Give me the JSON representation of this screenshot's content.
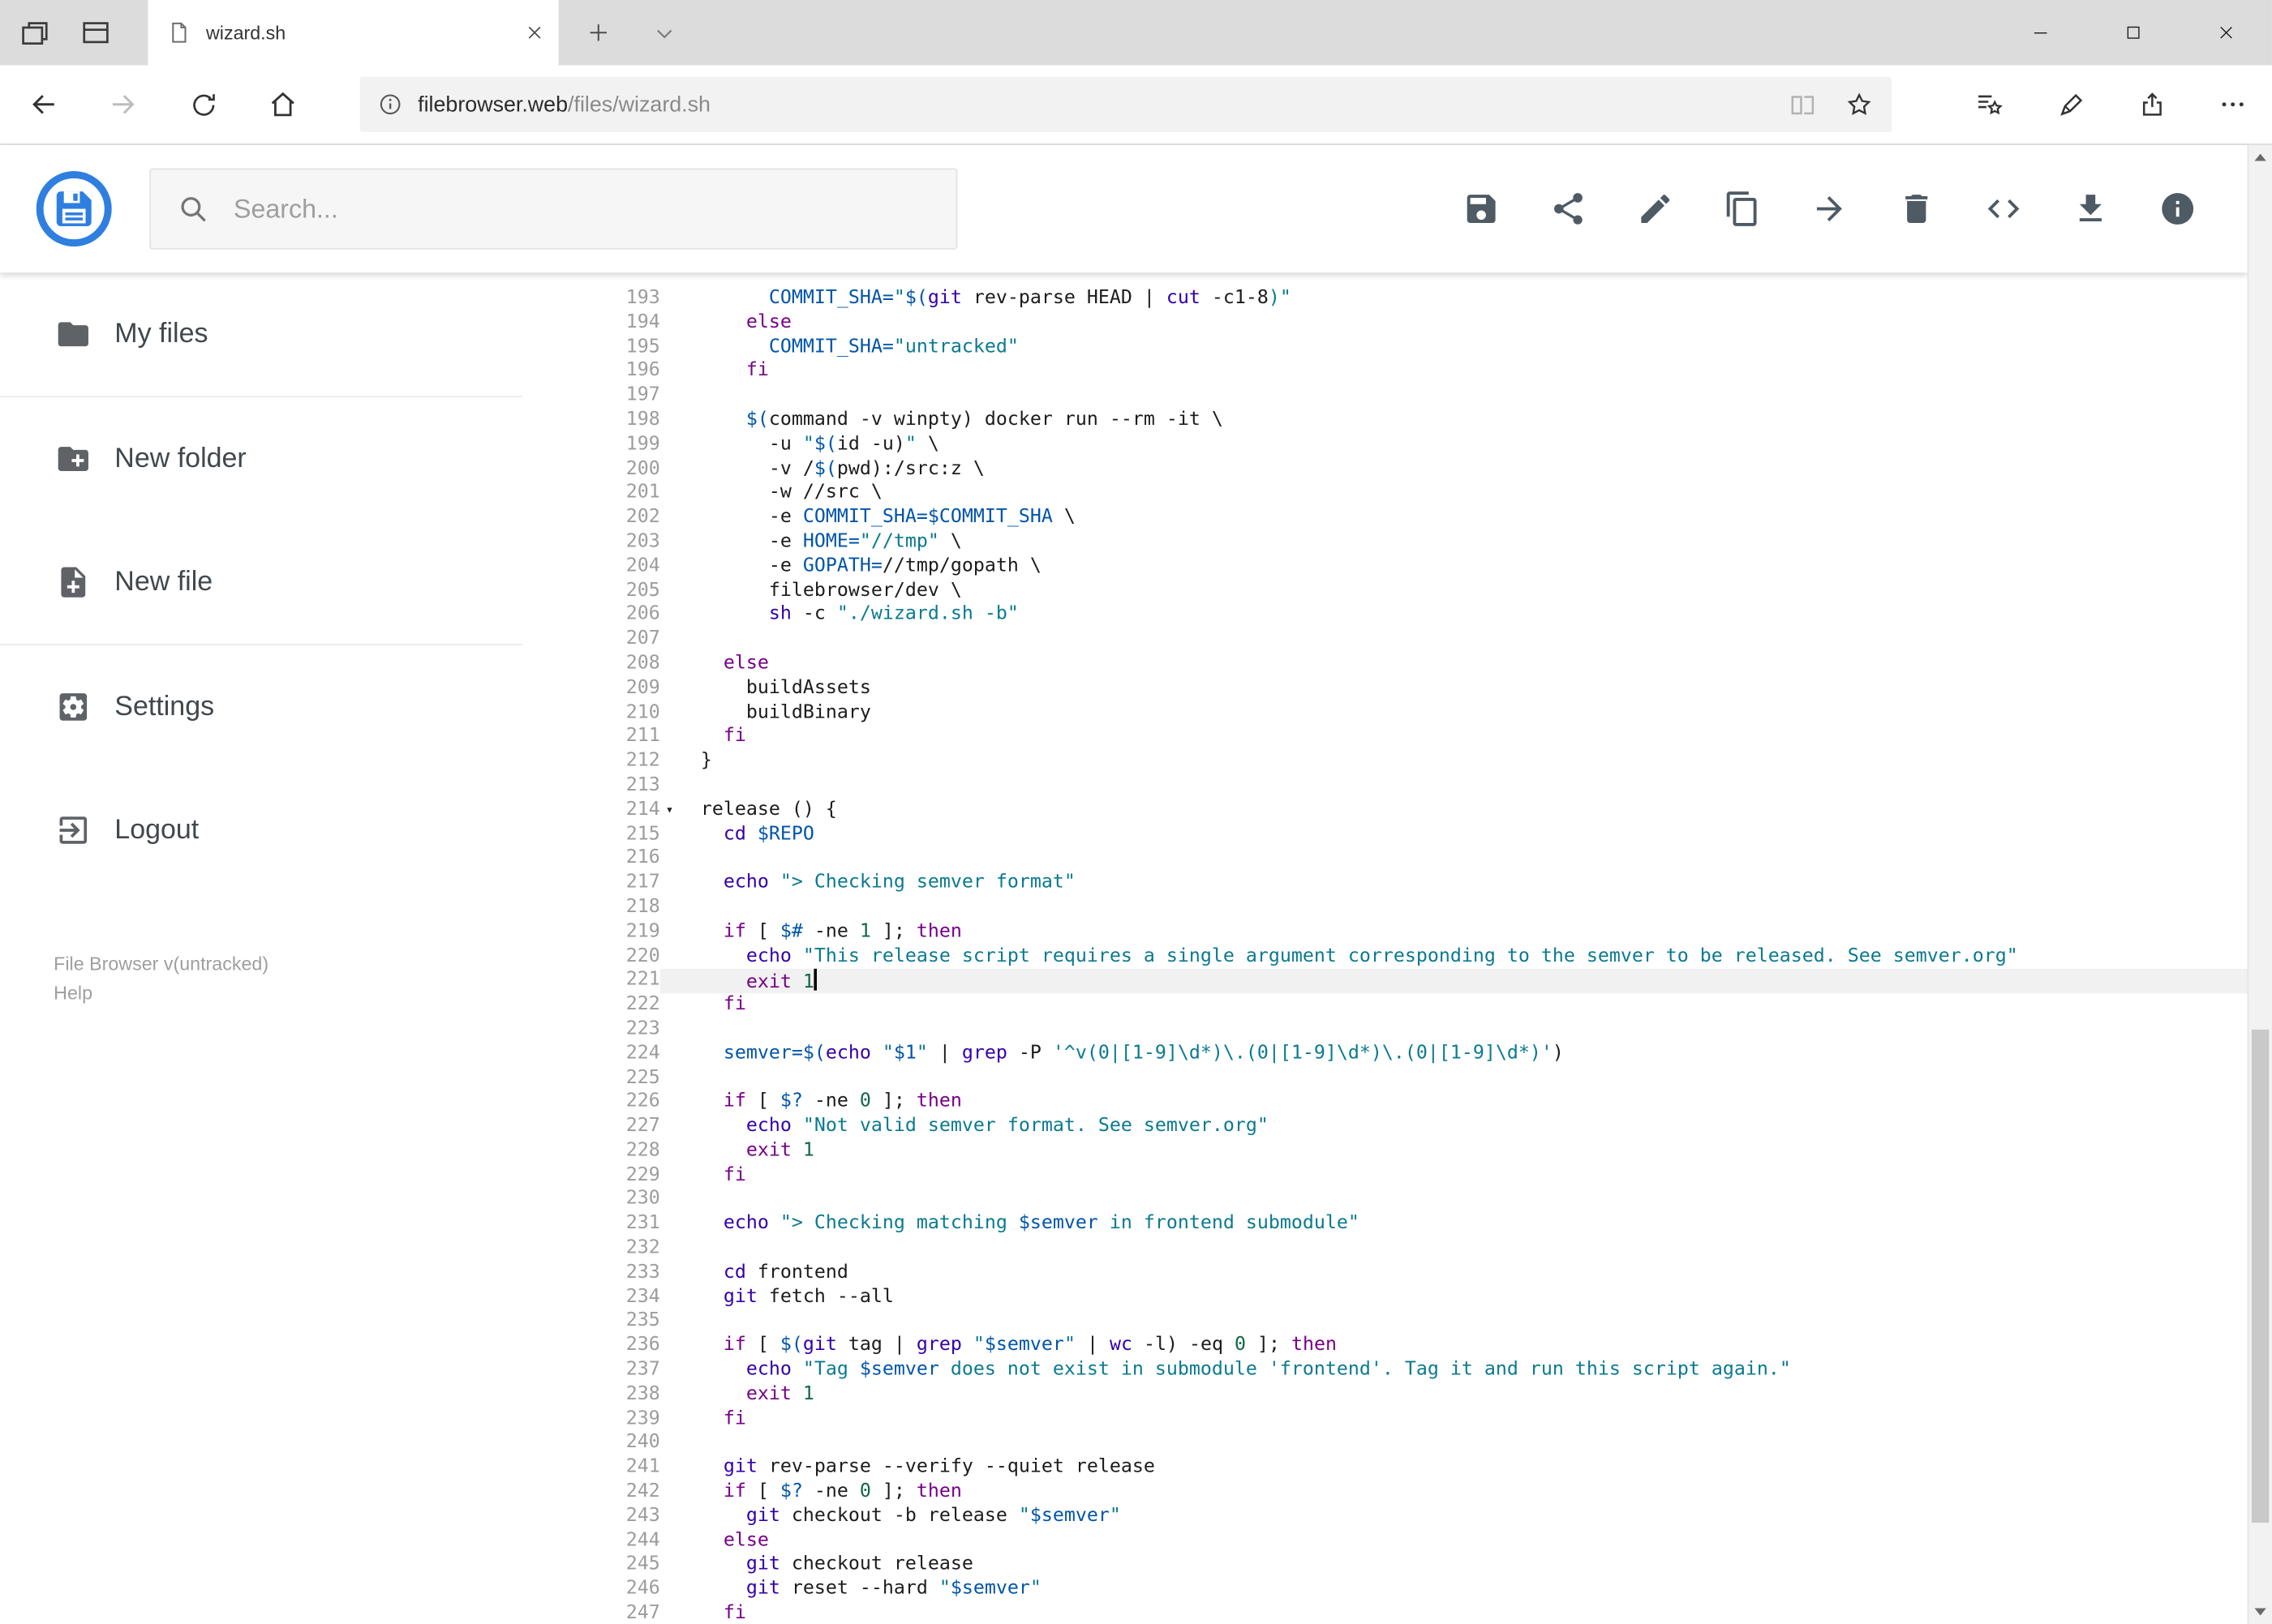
{
  "browser": {
    "tab_title": "wizard.sh",
    "url_host": "filebrowser.web",
    "url_path": "/files/wizard.sh"
  },
  "header": {
    "search_placeholder": "Search...",
    "toolbar_icons": [
      "save",
      "share",
      "rename",
      "copy",
      "move",
      "delete",
      "raw-code",
      "download",
      "info"
    ]
  },
  "sidebar": {
    "items": [
      {
        "label": "My files",
        "icon": "folder-icon"
      },
      {
        "label": "New folder",
        "icon": "new-folder-icon"
      },
      {
        "label": "New file",
        "icon": "new-file-icon"
      },
      {
        "label": "Settings",
        "icon": "settings-icon"
      },
      {
        "label": "Logout",
        "icon": "logout-icon"
      }
    ],
    "footer_version": "File Browser v(untracked)",
    "footer_help": "Help"
  },
  "editor": {
    "language": "shell",
    "first_line": 193,
    "last_line": 247,
    "active_line": 221,
    "cursor_line": 221,
    "fold_marker_line": 214,
    "colors": {
      "keyword": "#770088",
      "builtin": "#3300aa",
      "string": "#0b7a8f",
      "variable": "#0055aa",
      "number": "#116644",
      "plain": "#1c1c1c"
    },
    "lines": [
      {
        "n": 193,
        "t": [
          [
            "p",
            "      "
          ],
          [
            "d",
            "COMMIT_SHA="
          ],
          [
            "s",
            "\""
          ],
          [
            "d",
            "$("
          ],
          [
            "b",
            "git"
          ],
          [
            "p",
            " rev-parse HEAD | "
          ],
          [
            "b",
            "cut"
          ],
          [
            "p",
            " -c1-8"
          ],
          [
            "s",
            ")\""
          ]
        ]
      },
      {
        "n": 194,
        "t": [
          [
            "p",
            "    "
          ],
          [
            "k",
            "else"
          ]
        ]
      },
      {
        "n": 195,
        "t": [
          [
            "p",
            "      "
          ],
          [
            "d",
            "COMMIT_SHA="
          ],
          [
            "s",
            "\"untracked\""
          ]
        ]
      },
      {
        "n": 196,
        "t": [
          [
            "p",
            "    "
          ],
          [
            "k",
            "fi"
          ]
        ]
      },
      {
        "n": 197,
        "t": []
      },
      {
        "n": 198,
        "t": [
          [
            "p",
            "    "
          ],
          [
            "d",
            "$("
          ],
          [
            "p",
            "command -v winpty) docker run --rm -it \\"
          ]
        ]
      },
      {
        "n": 199,
        "t": [
          [
            "p",
            "      -u "
          ],
          [
            "s",
            "\""
          ],
          [
            "d",
            "$("
          ],
          [
            "p",
            "id -u)"
          ],
          [
            "s",
            "\""
          ],
          [
            "p",
            " \\"
          ]
        ]
      },
      {
        "n": 200,
        "t": [
          [
            "p",
            "      -v /"
          ],
          [
            "d",
            "$("
          ],
          [
            "p",
            "pwd):/src:z \\"
          ]
        ]
      },
      {
        "n": 201,
        "t": [
          [
            "p",
            "      -w //src \\"
          ]
        ]
      },
      {
        "n": 202,
        "t": [
          [
            "p",
            "      -e "
          ],
          [
            "d",
            "COMMIT_SHA=$COMMIT_SHA"
          ],
          [
            "p",
            " \\"
          ]
        ]
      },
      {
        "n": 203,
        "t": [
          [
            "p",
            "      -e "
          ],
          [
            "d",
            "HOME="
          ],
          [
            "s",
            "\"//tmp\""
          ],
          [
            "p",
            " \\"
          ]
        ]
      },
      {
        "n": 204,
        "t": [
          [
            "p",
            "      -e "
          ],
          [
            "d",
            "GOPATH="
          ],
          [
            "p",
            "//tmp/gopath \\"
          ]
        ]
      },
      {
        "n": 205,
        "t": [
          [
            "p",
            "      filebrowser/dev \\"
          ]
        ]
      },
      {
        "n": 206,
        "t": [
          [
            "p",
            "      "
          ],
          [
            "b",
            "sh"
          ],
          [
            "p",
            " -c "
          ],
          [
            "s",
            "\"./wizard.sh -b\""
          ]
        ]
      },
      {
        "n": 207,
        "t": []
      },
      {
        "n": 208,
        "t": [
          [
            "p",
            "  "
          ],
          [
            "k",
            "else"
          ]
        ]
      },
      {
        "n": 209,
        "t": [
          [
            "p",
            "    buildAssets"
          ]
        ]
      },
      {
        "n": 210,
        "t": [
          [
            "p",
            "    buildBinary"
          ]
        ]
      },
      {
        "n": 211,
        "t": [
          [
            "p",
            "  "
          ],
          [
            "k",
            "fi"
          ]
        ]
      },
      {
        "n": 212,
        "t": [
          [
            "p",
            "}"
          ]
        ]
      },
      {
        "n": 213,
        "t": []
      },
      {
        "n": 214,
        "t": [
          [
            "p",
            "release () {"
          ]
        ]
      },
      {
        "n": 215,
        "t": [
          [
            "p",
            "  "
          ],
          [
            "b",
            "cd"
          ],
          [
            "p",
            " "
          ],
          [
            "d",
            "$REPO"
          ]
        ]
      },
      {
        "n": 216,
        "t": []
      },
      {
        "n": 217,
        "t": [
          [
            "p",
            "  "
          ],
          [
            "b",
            "echo"
          ],
          [
            "p",
            " "
          ],
          [
            "s",
            "\"> Checking semver format\""
          ]
        ]
      },
      {
        "n": 218,
        "t": []
      },
      {
        "n": 219,
        "t": [
          [
            "p",
            "  "
          ],
          [
            "k",
            "if"
          ],
          [
            "p",
            " [ "
          ],
          [
            "d",
            "$#"
          ],
          [
            "p",
            " -ne "
          ],
          [
            "n",
            "1"
          ],
          [
            "p",
            " ]; "
          ],
          [
            "k",
            "then"
          ]
        ]
      },
      {
        "n": 220,
        "t": [
          [
            "p",
            "    "
          ],
          [
            "b",
            "echo"
          ],
          [
            "p",
            " "
          ],
          [
            "s",
            "\"This release script requires a single argument corresponding to the semver to be released. See semver.org\""
          ]
        ]
      },
      {
        "n": 221,
        "t": [
          [
            "p",
            "    "
          ],
          [
            "k",
            "exit"
          ],
          [
            "p",
            " "
          ],
          [
            "n",
            "1"
          ]
        ]
      },
      {
        "n": 222,
        "t": [
          [
            "p",
            "  "
          ],
          [
            "k",
            "fi"
          ]
        ]
      },
      {
        "n": 223,
        "t": []
      },
      {
        "n": 224,
        "t": [
          [
            "p",
            "  "
          ],
          [
            "d",
            "semver="
          ],
          [
            "d",
            "$("
          ],
          [
            "b",
            "echo"
          ],
          [
            "p",
            " "
          ],
          [
            "s",
            "\""
          ],
          [
            "d",
            "$1"
          ],
          [
            "s",
            "\""
          ],
          [
            "p",
            " | "
          ],
          [
            "b",
            "grep"
          ],
          [
            "p",
            " -P "
          ],
          [
            "s",
            "'^v(0|[1-9]\\d*)\\.(0|[1-9]\\d*)\\.(0|[1-9]\\d*)'"
          ],
          [
            "p",
            ")"
          ]
        ]
      },
      {
        "n": 225,
        "t": []
      },
      {
        "n": 226,
        "t": [
          [
            "p",
            "  "
          ],
          [
            "k",
            "if"
          ],
          [
            "p",
            " [ "
          ],
          [
            "d",
            "$?"
          ],
          [
            "p",
            " -ne "
          ],
          [
            "n",
            "0"
          ],
          [
            "p",
            " ]; "
          ],
          [
            "k",
            "then"
          ]
        ]
      },
      {
        "n": 227,
        "t": [
          [
            "p",
            "    "
          ],
          [
            "b",
            "echo"
          ],
          [
            "p",
            " "
          ],
          [
            "s",
            "\"Not valid semver format. See semver.org\""
          ]
        ]
      },
      {
        "n": 228,
        "t": [
          [
            "p",
            "    "
          ],
          [
            "k",
            "exit"
          ],
          [
            "p",
            " "
          ],
          [
            "n",
            "1"
          ]
        ]
      },
      {
        "n": 229,
        "t": [
          [
            "p",
            "  "
          ],
          [
            "k",
            "fi"
          ]
        ]
      },
      {
        "n": 230,
        "t": []
      },
      {
        "n": 231,
        "t": [
          [
            "p",
            "  "
          ],
          [
            "b",
            "echo"
          ],
          [
            "p",
            " "
          ],
          [
            "s",
            "\"> Checking matching "
          ],
          [
            "d",
            "$semver"
          ],
          [
            "s",
            " in frontend submodule\""
          ]
        ]
      },
      {
        "n": 232,
        "t": []
      },
      {
        "n": 233,
        "t": [
          [
            "p",
            "  "
          ],
          [
            "b",
            "cd"
          ],
          [
            "p",
            " frontend"
          ]
        ]
      },
      {
        "n": 234,
        "t": [
          [
            "p",
            "  "
          ],
          [
            "b",
            "git"
          ],
          [
            "p",
            " fetch --all"
          ]
        ]
      },
      {
        "n": 235,
        "t": []
      },
      {
        "n": 236,
        "t": [
          [
            "p",
            "  "
          ],
          [
            "k",
            "if"
          ],
          [
            "p",
            " [ "
          ],
          [
            "d",
            "$("
          ],
          [
            "b",
            "git"
          ],
          [
            "p",
            " tag | "
          ],
          [
            "b",
            "grep"
          ],
          [
            "p",
            " "
          ],
          [
            "s",
            "\""
          ],
          [
            "d",
            "$semver"
          ],
          [
            "s",
            "\""
          ],
          [
            "p",
            " | "
          ],
          [
            "b",
            "wc"
          ],
          [
            "p",
            " -l) -eq "
          ],
          [
            "n",
            "0"
          ],
          [
            "p",
            " ]; "
          ],
          [
            "k",
            "then"
          ]
        ]
      },
      {
        "n": 237,
        "t": [
          [
            "p",
            "    "
          ],
          [
            "b",
            "echo"
          ],
          [
            "p",
            " "
          ],
          [
            "s",
            "\"Tag "
          ],
          [
            "d",
            "$semver"
          ],
          [
            "s",
            " does not exist in submodule 'frontend'. Tag it and run this script again.\""
          ]
        ]
      },
      {
        "n": 238,
        "t": [
          [
            "p",
            "    "
          ],
          [
            "k",
            "exit"
          ],
          [
            "p",
            " "
          ],
          [
            "n",
            "1"
          ]
        ]
      },
      {
        "n": 239,
        "t": [
          [
            "p",
            "  "
          ],
          [
            "k",
            "fi"
          ]
        ]
      },
      {
        "n": 240,
        "t": []
      },
      {
        "n": 241,
        "t": [
          [
            "p",
            "  "
          ],
          [
            "b",
            "git"
          ],
          [
            "p",
            " rev-parse --verify --quiet release"
          ]
        ]
      },
      {
        "n": 242,
        "t": [
          [
            "p",
            "  "
          ],
          [
            "k",
            "if"
          ],
          [
            "p",
            " [ "
          ],
          [
            "d",
            "$?"
          ],
          [
            "p",
            " -ne "
          ],
          [
            "n",
            "0"
          ],
          [
            "p",
            " ]; "
          ],
          [
            "k",
            "then"
          ]
        ]
      },
      {
        "n": 243,
        "t": [
          [
            "p",
            "    "
          ],
          [
            "b",
            "git"
          ],
          [
            "p",
            " checkout -b release "
          ],
          [
            "s",
            "\""
          ],
          [
            "d",
            "$semver"
          ],
          [
            "s",
            "\""
          ]
        ]
      },
      {
        "n": 244,
        "t": [
          [
            "p",
            "  "
          ],
          [
            "k",
            "else"
          ]
        ]
      },
      {
        "n": 245,
        "t": [
          [
            "p",
            "    "
          ],
          [
            "b",
            "git"
          ],
          [
            "p",
            " checkout release"
          ]
        ]
      },
      {
        "n": 246,
        "t": [
          [
            "p",
            "    "
          ],
          [
            "b",
            "git"
          ],
          [
            "p",
            " reset --hard "
          ],
          [
            "s",
            "\""
          ],
          [
            "d",
            "$semver"
          ],
          [
            "s",
            "\""
          ]
        ]
      },
      {
        "n": 247,
        "t": [
          [
            "p",
            "  "
          ],
          [
            "k",
            "fi"
          ]
        ]
      }
    ]
  }
}
